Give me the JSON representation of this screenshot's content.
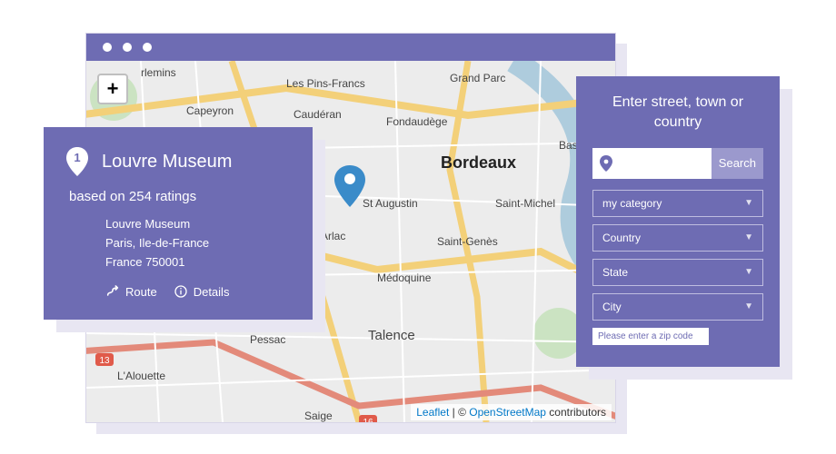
{
  "card": {
    "rank": "1",
    "title": "Louvre Museum",
    "ratings": "based on 254 ratings",
    "addr1": "Louvre Museum",
    "addr2": "Paris, Ile-de-France",
    "addr3": "France 750001",
    "route": "Route",
    "details": "Details"
  },
  "panel": {
    "heading": "Enter street, town or country",
    "search_btn": "Search",
    "search_placeholder": "",
    "dropdowns": {
      "category": "my category",
      "country": "Country",
      "state": "State",
      "city": "City"
    },
    "zip_placeholder": "Please enter a zip code"
  },
  "attribution": {
    "leaflet": "Leaflet",
    "sep": " | © ",
    "osm": "OpenStreetMap",
    "tail": " contributors"
  },
  "zoom_in": "+",
  "map_labels": {
    "bordeaux": "Bordeaux",
    "grand_parc": "Grand Parc",
    "les_pins": "Les Pins-Francs",
    "capeyron": "Capeyron",
    "cauderan": "Caudéran",
    "fondaudege": "Fondaudège",
    "arlac": "Arlac",
    "st_augustin": "St Augustin",
    "st_genes": "Saint-Genès",
    "st_michel": "Saint-Michel",
    "bast": "Bast",
    "medoquine": "Médoquine",
    "pessac": "Pessac",
    "lalouette": "L'Alouette",
    "talence": "Talence",
    "saige": "Saige",
    "flemins": "rlemins"
  }
}
